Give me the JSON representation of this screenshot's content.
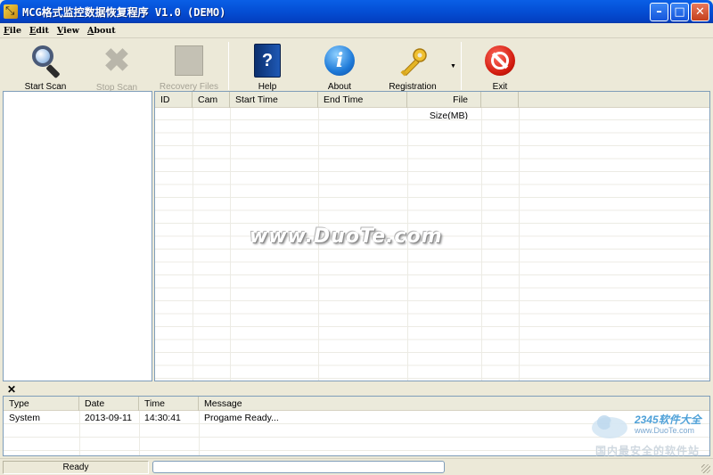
{
  "window": {
    "title": "MCG格式监控数据恢复程序 V1.0 (DEMO)",
    "controls": {
      "minimize": "–",
      "maximize": "□",
      "close": "✕"
    }
  },
  "menu": [
    {
      "key": "F",
      "rest": "ile"
    },
    {
      "key": "E",
      "rest": "dit"
    },
    {
      "key": "V",
      "rest": "iew"
    },
    {
      "key": "A",
      "rest": "bout"
    }
  ],
  "toolbar": {
    "start_scan": {
      "label": "Start Scan",
      "icon": "magnifier-icon",
      "enabled": true
    },
    "stop_scan": {
      "label": "Stop Scan",
      "icon": "x-icon",
      "enabled": false
    },
    "recovery_files": {
      "label": "Recovery  Files",
      "icon": "recovery-icon",
      "enabled": false
    },
    "help": {
      "label": "Help",
      "icon": "help-book-icon",
      "enabled": true
    },
    "about": {
      "label": "About",
      "icon": "info-icon",
      "enabled": true
    },
    "registration": {
      "label": "Registration",
      "icon": "key-icon",
      "enabled": true,
      "dropdown": "▼"
    },
    "exit": {
      "label": "Exit",
      "icon": "stop-sign-icon",
      "enabled": true
    }
  },
  "file_list": {
    "columns": [
      "ID",
      "Cam",
      "Start Time",
      "End Time",
      "File Size(MB)"
    ],
    "rows": []
  },
  "watermark_center": "www.DuoTe.com",
  "log": {
    "close_glyph": "✕",
    "columns": [
      "Type",
      "Date",
      "Time",
      "Message"
    ],
    "rows": [
      {
        "type": "System",
        "date": "2013-09-11",
        "time": "14:30:41",
        "message": "Progame Ready..."
      }
    ]
  },
  "site_watermark": {
    "brand": "2345软件大全",
    "url": "www.DuoTe.com",
    "slogan": "国内最安全的软件站"
  },
  "status": {
    "text": "Ready",
    "progress": 0
  },
  "colors": {
    "titlebar": "#0551d8",
    "chrome": "#ece9d8",
    "list_border": "#7f9db9",
    "header_bg": "#ebeadb",
    "disabled_text": "#a5a295"
  }
}
